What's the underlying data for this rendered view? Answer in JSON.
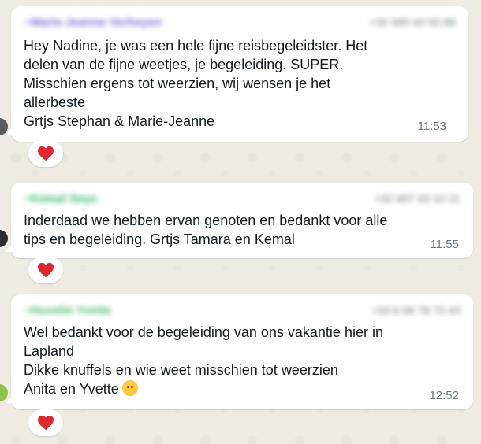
{
  "colors": {
    "background": "#efeae2",
    "bubble": "#ffffff",
    "text": "#111b21",
    "timestamp": "#667781",
    "reaction_heart": "#e0262f"
  },
  "messages": [
    {
      "sender_name": "~Marie-Jeanne Verheyen",
      "sender_phone": "+32 495 43 55 86",
      "name_color": "#7b6fd6",
      "lines": [
        "Hey Nadine, je was een hele fijne reisbegeleidster. Het",
        "delen van de fijne weetjes, je begeleiding. SUPER.",
        "Misschien ergens tot weerzien, wij wensen je het",
        "allerbeste",
        "Grtjs Stephan & Marie-Jeanne"
      ],
      "time": "11:53",
      "reaction_icon": "red-heart-icon"
    },
    {
      "sender_name": "~Kemal Seys",
      "sender_phone": "+32 497 43 10 21",
      "name_color": "#35b76a",
      "lines": [
        "Inderdaad we hebben ervan genoten en bedankt voor alle",
        "tips en begeleiding. Grtjs Tamara en Kemal"
      ],
      "time": "11:55",
      "reaction_icon": "red-heart-icon"
    },
    {
      "sender_name": "~Huvelin Yvette",
      "sender_phone": "+33 6 58 78 70 43",
      "name_color": "#47b86c",
      "lines": [
        "Wel bedankt voor de begeleiding van ons vakantie hier in",
        "Lapland",
        "Dikke knuffels en wie weet misschien tot weerzien",
        "Anita en Yvette"
      ],
      "time": "12:52",
      "reaction_icon": "red-heart-icon",
      "trailing_emoji": "hugging-face-emoji"
    }
  ]
}
